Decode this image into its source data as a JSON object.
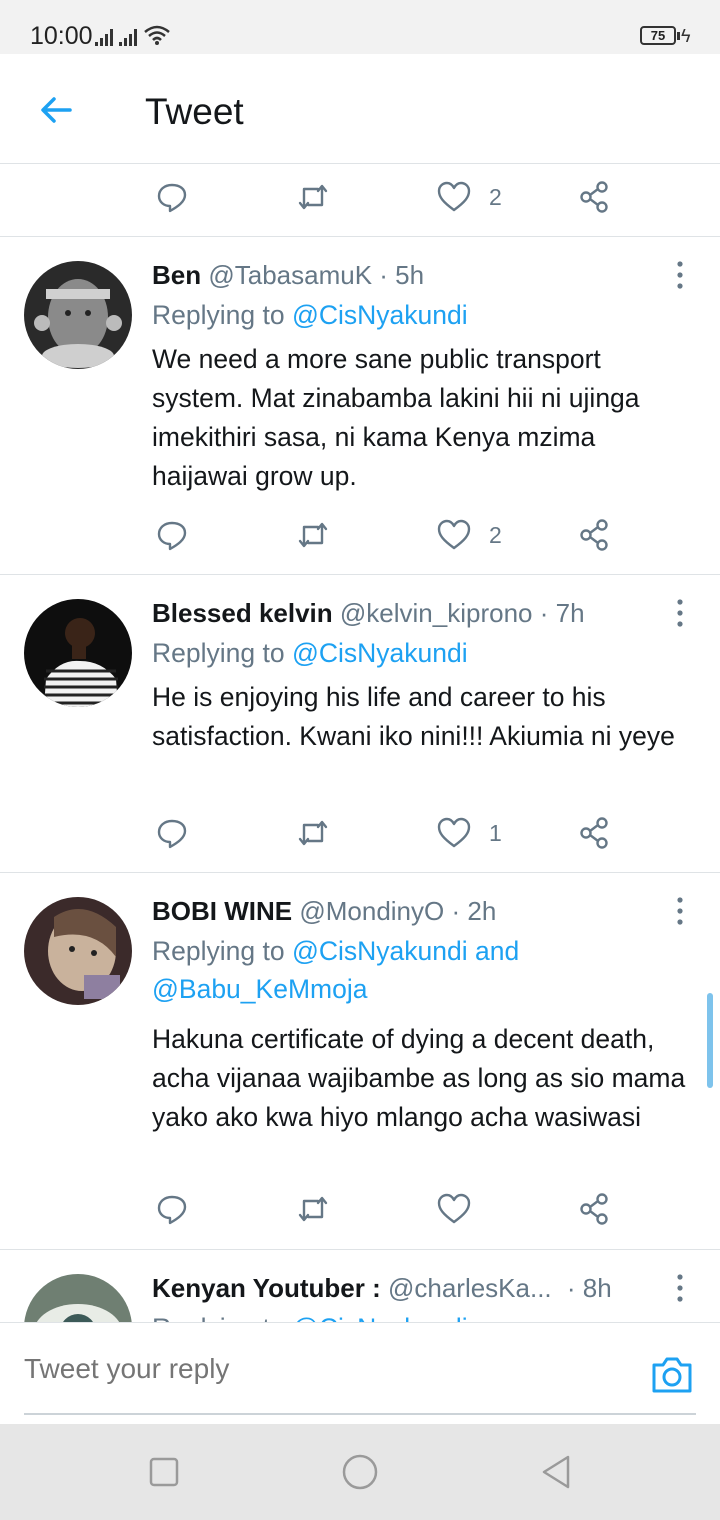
{
  "status_bar": {
    "time": "10:00",
    "battery": "75"
  },
  "header": {
    "title": "Tweet"
  },
  "top_actions": {
    "likes": "2"
  },
  "tweets": [
    {
      "name": "Ben",
      "handle": "@TabasamuK",
      "time": "· 5h",
      "replying_prefix": "Replying to",
      "replying_to": "@CisNyakundi",
      "replying_line2": "",
      "text": "We need a more sane public transport system. Mat zinabamba lakini hii ni ujinga imekithiri  sasa, ni kama Kenya mzima haijawai grow up.",
      "likes": "2"
    },
    {
      "name": "Blessed kelvin",
      "handle": "@kelvin_kiprono",
      "time": "· 7h",
      "replying_prefix": "Replying to",
      "replying_to": "@CisNyakundi",
      "replying_line2": "",
      "text": "He is enjoying his life and career to his satisfaction. Kwani iko nini!!! Akiumia ni yeye",
      "likes": "1"
    },
    {
      "name": "BOBI WINE",
      "handle": "@MondinyO",
      "time": "· 2h",
      "replying_prefix": "Replying to",
      "replying_to": "@CisNyakundi and",
      "replying_line2": "@Babu_KeMmoja",
      "text": "Hakuna certificate of dying a decent death, acha vijanaa wajibambe as long as sio mama yako ako kwa hiyo mlango acha wasiwasi",
      "likes": ""
    },
    {
      "name": "Kenyan Youtuber :",
      "handle": "@charlesKa...",
      "time": "· 8h",
      "replying_prefix": "Replying to",
      "replying_to": "@CisNyakundi",
      "replying_line2": "",
      "text": "",
      "likes": ""
    }
  ],
  "composer": {
    "placeholder": "Tweet your reply"
  },
  "colors": {
    "accent": "#1da1f2",
    "secondary_text": "#657786",
    "divider": "#dfe3e6"
  },
  "icons": [
    "back-arrow-icon",
    "reply-icon",
    "retweet-icon",
    "like-heart-icon",
    "share-icon",
    "more-vert-icon",
    "camera-icon",
    "recent-apps-icon",
    "home-icon",
    "back-triangle-icon"
  ]
}
